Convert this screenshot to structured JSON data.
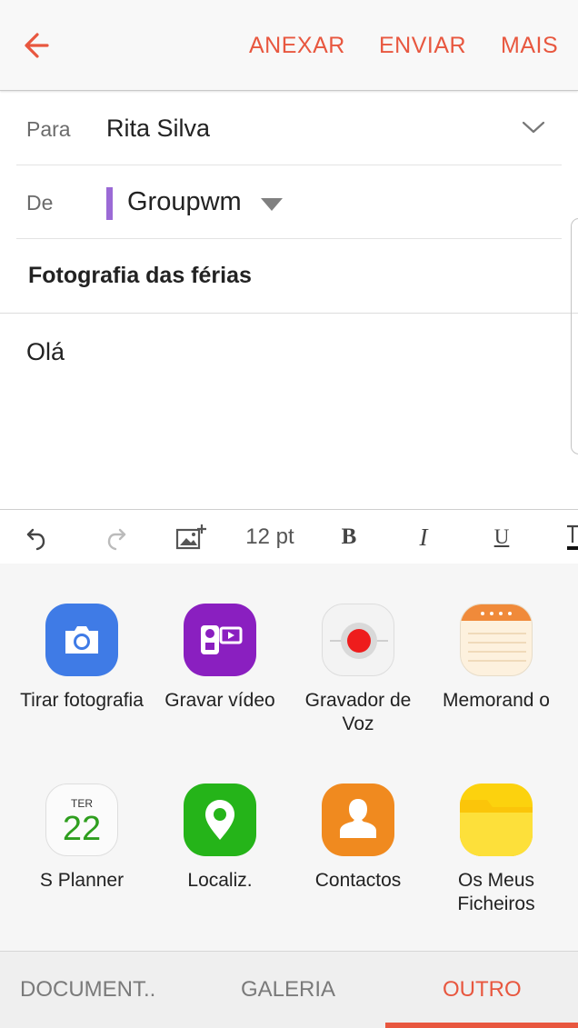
{
  "colors": {
    "accent": "#e8573f",
    "label": "#6b6b6b",
    "sender_bar": "#9b6ad6"
  },
  "appbar": {
    "back_icon": "arrow-left-icon",
    "actions": [
      "ANEXAR",
      "ENVIAR",
      "MAIS"
    ]
  },
  "compose": {
    "to_label": "Para",
    "to_value": "Rita Silva",
    "from_label": "De",
    "from_value": "Groupwm",
    "subject": "Fotografia das férias",
    "body": "Olá"
  },
  "toolbar": {
    "font_size": "12 pt",
    "bold": "B",
    "italic": "I",
    "underline": "U"
  },
  "apps": [
    {
      "label": "Tirar fotografia",
      "icon": "camera-icon"
    },
    {
      "label": "Gravar vídeo",
      "icon": "video-camera-icon"
    },
    {
      "label": "Gravador de Voz",
      "icon": "voice-recorder-icon"
    },
    {
      "label": "Memorand o",
      "icon": "memo-icon"
    },
    {
      "label": "S Planner",
      "icon": "calendar-icon",
      "day": "TER",
      "date": "22"
    },
    {
      "label": "Localiz.",
      "icon": "location-pin-icon"
    },
    {
      "label": "Contactos",
      "icon": "contacts-icon"
    },
    {
      "label": "Os Meus Ficheiros",
      "icon": "folder-icon"
    }
  ],
  "tabs": [
    {
      "label": "DOCUMENT.."
    },
    {
      "label": "GALERIA"
    },
    {
      "label": "OUTRO",
      "active": true
    }
  ]
}
